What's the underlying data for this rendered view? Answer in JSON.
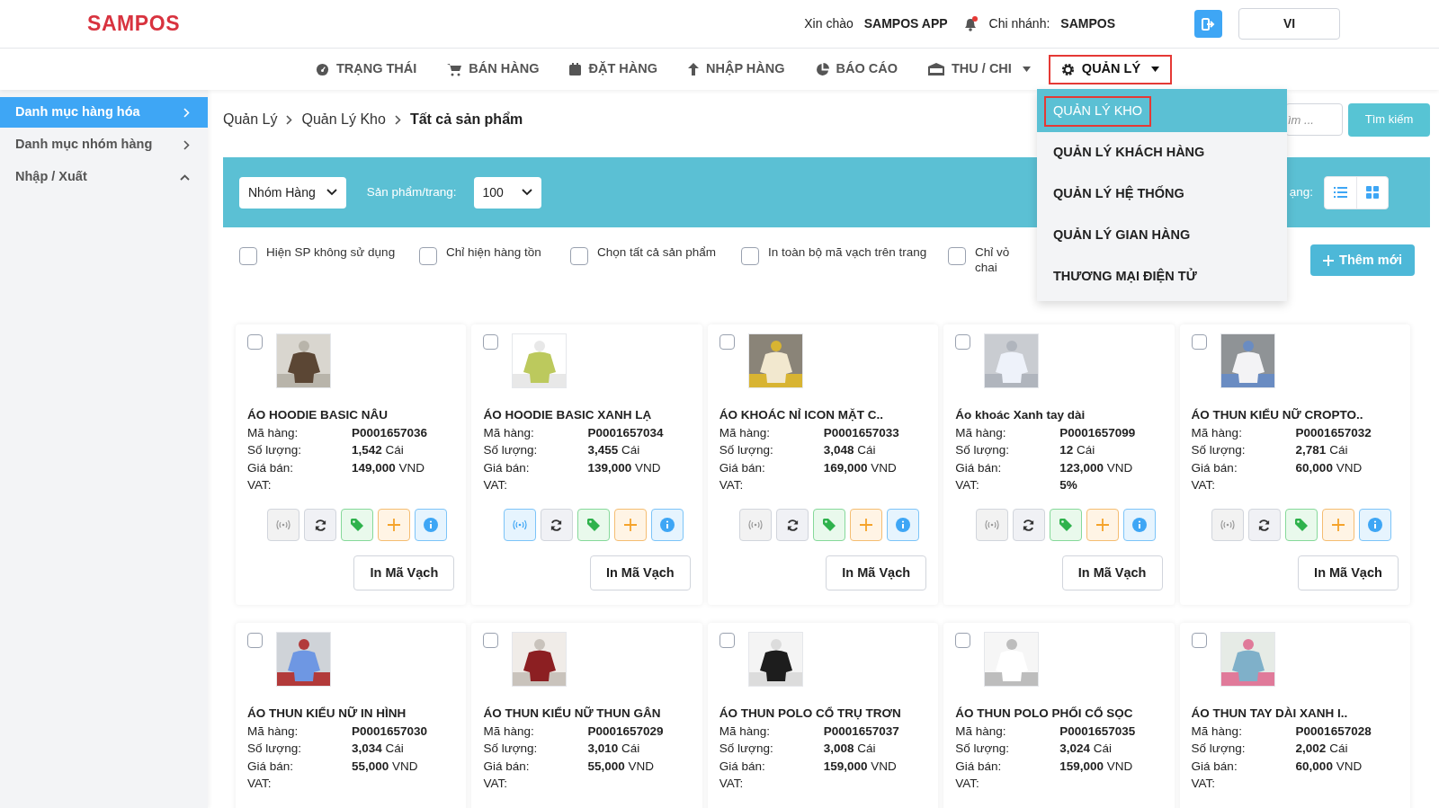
{
  "header": {
    "logo": "SAMPOS",
    "greeting": "Xin chào",
    "user": "SAMPOS APP",
    "branch_label": "Chi nhánh:",
    "branch": "SAMPOS",
    "notification_dot": true,
    "language": "VI"
  },
  "nav": [
    {
      "label": "TRẠNG THÁI",
      "caret": false,
      "selected": false
    },
    {
      "label": "BÁN HÀNG",
      "caret": false,
      "selected": false
    },
    {
      "label": "ĐẶT HÀNG",
      "caret": false,
      "selected": false
    },
    {
      "label": "NHẬP HÀNG",
      "caret": false,
      "selected": false
    },
    {
      "label": "BÁO CÁO",
      "caret": false,
      "selected": false
    },
    {
      "label": "THU / CHI",
      "caret": true,
      "selected": false
    },
    {
      "label": "QUẢN LÝ",
      "caret": true,
      "selected": true
    }
  ],
  "dropdown": [
    {
      "label": "QUẢN LÝ KHO",
      "selected": true
    },
    {
      "label": "QUẢN LÝ KHÁCH HÀNG",
      "selected": false
    },
    {
      "label": "QUẢN LÝ HỆ THỐNG",
      "selected": false
    },
    {
      "label": "QUẢN LÝ GIAN HÀNG",
      "selected": false
    },
    {
      "label": "THƯƠNG MẠI ĐIỆN TỬ",
      "selected": false
    }
  ],
  "sidebar": {
    "items": [
      {
        "label": "Danh mục hàng hóa",
        "selected": true,
        "expanded": false
      },
      {
        "label": "Danh mục nhóm hàng",
        "selected": false,
        "expanded": false
      },
      {
        "label": "Nhập / Xuất",
        "selected": false,
        "expanded": true
      }
    ]
  },
  "breadcrumb": [
    "Quản Lý",
    "Quản Lý Kho",
    "Tất cả sản phẩm"
  ],
  "search": {
    "placeholder": "ìm ...",
    "button": "Tìm kiếm"
  },
  "filter_bar": {
    "group_select": "Nhóm Hàng",
    "per_page_label": "Sản phẩm/trang:",
    "per_page": "100",
    "view_label": "ạng:"
  },
  "options": [
    {
      "label": "Hiện SP không sử dụng",
      "checked": false
    },
    {
      "label": "Chỉ hiện hàng tồn",
      "checked": false
    },
    {
      "label": "Chọn tất cả sản phẩm",
      "checked": false
    },
    {
      "label": "In toàn bộ mã vạch trên trang",
      "checked": false
    },
    {
      "label": "Chỉ vỏ chai",
      "checked": false
    }
  ],
  "add_button": "Thêm mới",
  "products": [
    {
      "name": "ÁO HOODIE BASIC NÂU",
      "checked": false,
      "rfid_on": false,
      "print_button": "In Mã Vạch",
      "fields": [
        {
          "label": "Mã hàng:",
          "value": "**P0001657036**"
        },
        {
          "label": "Số lượng:",
          "value": "**1,542** Cái"
        },
        {
          "label": "Giá bán:",
          "value": "**149,000** VND"
        },
        {
          "label": "VAT:"
        }
      ]
    },
    {
      "name": "ÁO HOODIE BASIC XANH LẠ",
      "checked": false,
      "rfid_on": true,
      "print_button": "In Mã Vạch",
      "fields": [
        {
          "label": "Mã hàng:",
          "value": "**P0001657034**"
        },
        {
          "label": "Số lượng:",
          "value": "**3,455** Cái"
        },
        {
          "label": "Giá bán:",
          "value": "**139,000** VND"
        },
        {
          "label": "VAT:"
        }
      ]
    },
    {
      "name": "ÁO KHOÁC NỈ ICON MẶT C..",
      "checked": false,
      "rfid_on": false,
      "print_button": "In Mã Vạch",
      "fields": [
        {
          "label": "Mã hàng:",
          "value": "**P0001657033**"
        },
        {
          "label": "Số lượng:",
          "value": "**3,048** Cái"
        },
        {
          "label": "Giá bán:",
          "value": "**169,000** VND"
        },
        {
          "label": "VAT:"
        }
      ]
    },
    {
      "name": "Áo khoác Xanh tay dài",
      "checked": false,
      "rfid_on": false,
      "print_button": "In Mã Vạch",
      "fields": [
        {
          "label": "Mã hàng:",
          "value": "**P0001657099**"
        },
        {
          "label": "Số lượng:",
          "value": "**12** Cái"
        },
        {
          "label": "Giá bán:",
          "value": "**123,000** VND"
        },
        {
          "label": "VAT:",
          "value": "**5%**"
        }
      ]
    },
    {
      "name": "ÁO THUN KIỂU NỮ CROPTO..",
      "checked": false,
      "rfid_on": false,
      "print_button": "In Mã Vạch",
      "fields": [
        {
          "label": "Mã hàng:",
          "value": "**P0001657032**"
        },
        {
          "label": "Số lượng:",
          "value": "**2,781** Cái"
        },
        {
          "label": "Giá bán:",
          "value": "**60,000** VND"
        },
        {
          "label": "VAT:"
        }
      ]
    },
    {
      "name": "ÁO THUN KIỂU NỮ IN HÌNH",
      "checked": false,
      "fields": [
        {
          "label": "Mã hàng:",
          "value": "**P0001657030**"
        },
        {
          "label": "Số lượng:",
          "value": "**3,034** Cái"
        },
        {
          "label": "Giá bán:",
          "value": "**55,000** VND"
        },
        {
          "label": "VAT:"
        }
      ]
    },
    {
      "name": "ÁO THUN KIỂU NỮ THUN GÂN",
      "checked": false,
      "fields": [
        {
          "label": "Mã hàng:",
          "value": "**P0001657029**"
        },
        {
          "label": "Số lượng:",
          "value": "**3,010** Cái"
        },
        {
          "label": "Giá bán:",
          "value": "**55,000** VND"
        },
        {
          "label": "VAT:"
        }
      ]
    },
    {
      "name": "ÁO THUN POLO CỔ TRỤ TRƠN",
      "checked": false,
      "fields": [
        {
          "label": "Mã hàng:",
          "value": "**P0001657037**"
        },
        {
          "label": "Số lượng:",
          "value": "**3,008** Cái"
        },
        {
          "label": "Giá bán:",
          "value": "**159,000** VND"
        },
        {
          "label": "VAT:"
        }
      ]
    },
    {
      "name": "ÁO THUN POLO PHỐI CỔ SỌC",
      "checked": false,
      "fields": [
        {
          "label": "Mã hàng:",
          "value": "**P0001657035**"
        },
        {
          "label": "Số lượng:",
          "value": "**3,024** Cái"
        },
        {
          "label": "Giá bán:",
          "value": "**159,000** VND"
        },
        {
          "label": "VAT:"
        }
      ]
    },
    {
      "name": "ÁO THUN TAY DÀI XANH I..",
      "checked": false,
      "fields": [
        {
          "label": "Mã hàng:",
          "value": "**P0001657028**"
        },
        {
          "label": "Số lượng:",
          "value": "**2,002** Cái"
        },
        {
          "label": "Giá bán:",
          "value": "**60,000** VND"
        },
        {
          "label": "VAT:"
        }
      ]
    }
  ]
}
